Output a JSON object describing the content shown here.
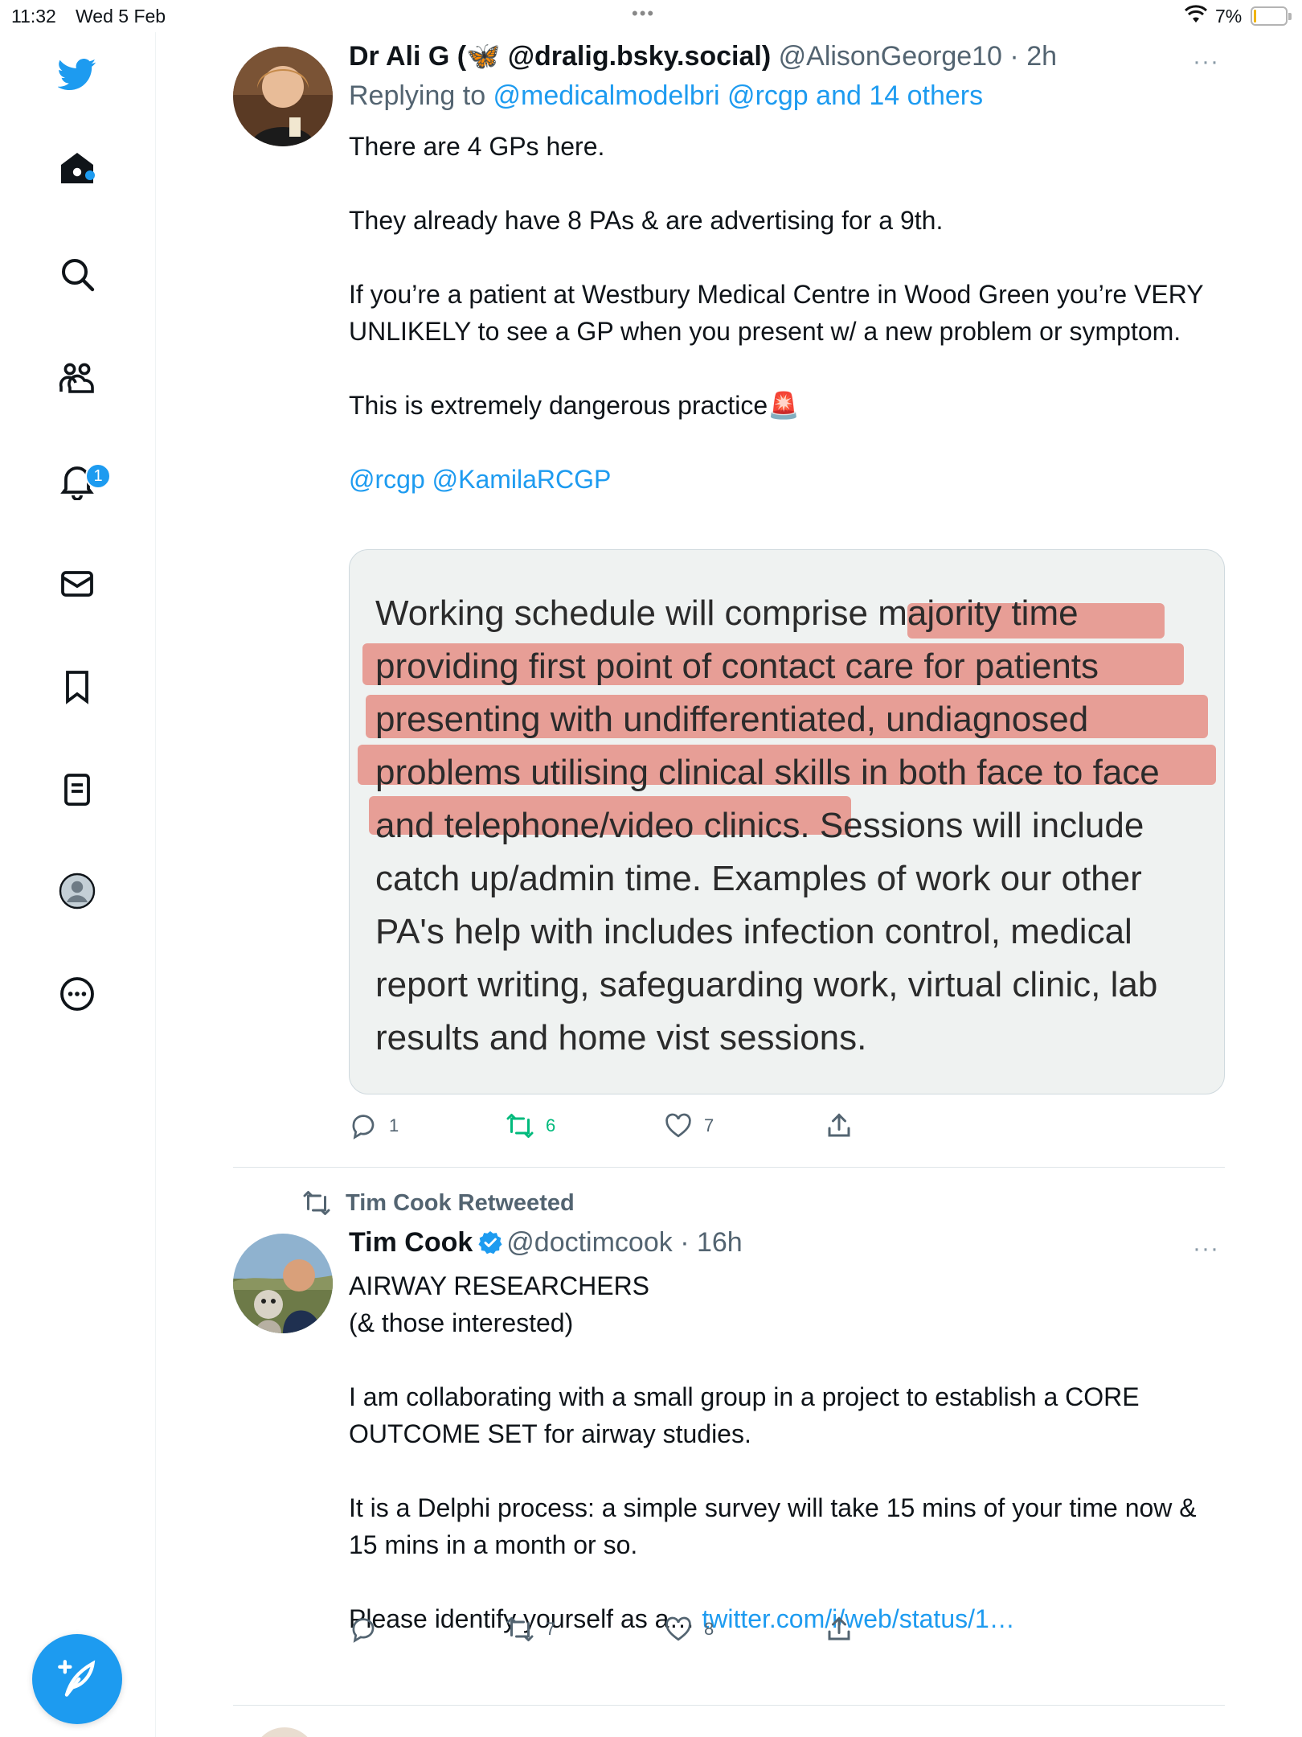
{
  "status_bar": {
    "time": "11:32",
    "date": "Wed 5 Feb",
    "battery_percent": "7%",
    "battery_level": 0.07
  },
  "sidebar": {
    "items": [
      {
        "icon": "twitter-logo-icon"
      },
      {
        "icon": "home-icon"
      },
      {
        "icon": "search-icon"
      },
      {
        "icon": "communities-icon"
      },
      {
        "icon": "notifications-icon",
        "badge": "1"
      },
      {
        "icon": "messages-icon"
      },
      {
        "icon": "bookmarks-icon"
      },
      {
        "icon": "lists-icon"
      },
      {
        "icon": "profile-icon"
      },
      {
        "icon": "more-icon"
      }
    ],
    "compose_icon": "compose-tweet-icon",
    "accent": "#1d9bf0"
  },
  "tweets": [
    {
      "name": "Dr Ali G (🦋 @dralig.bsky.social)",
      "handle": "@AlisonGeorge10",
      "sep": " · ",
      "ago": "2h",
      "replying_prefix": "Replying to ",
      "replying_to": "@medicalmodelbri @rcgp and 14 others",
      "paragraphs": [
        "There are 4 GPs here.",
        "They already have 8 PAs & are advertising for a 9th.",
        "If you’re a patient at Westbury Medical Centre in Wood Green you’re VERY UNLIKELY to see a GP when you present w/ a new problem or symptom.",
        "This is extremely dangerous practice🚨"
      ],
      "mentions": "@rcgp @KamilaRCGP",
      "image_text": "Working schedule will comprise majority time providing first point of contact care for patients presenting with undifferentiated, undiagnosed problems utilising clinical skills in both face to face and telephone/video clinics. Sessions will include catch up/admin time. Examples of work our other PA's help with includes infection control, medical report writing, safeguarding work, virtual clinic, lab results and home vist sessions.",
      "replies": "1",
      "retweets": "6",
      "likes": "7",
      "retweet_color": "#00ba7c"
    },
    {
      "retweeted_by": "Tim Cook Retweeted",
      "name": "Tim Cook",
      "handle": "@doctimcook",
      "sep": " · ",
      "ago": "16h",
      "paragraphs": [
        "AIRWAY RESEARCHERS",
        "(& those interested)",
        "I am collaborating with a small group in a project to establish a CORE OUTCOME SET for airway studies.",
        "It is a Delphi process: a simple survey will take 15 mins of your time now & 15 mins in a month or so."
      ],
      "truncated_text": "Please identify yourself as a… ",
      "truncated_link": "twitter.com/i/web/status/1…",
      "replies": "",
      "retweets": "7",
      "likes": "8"
    }
  ]
}
